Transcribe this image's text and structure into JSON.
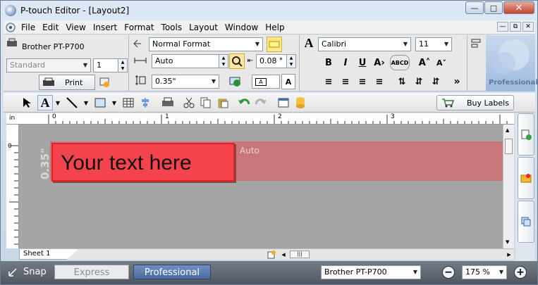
{
  "window": {
    "title": "P-touch Editor - [Layout2]"
  },
  "menu": [
    "File",
    "Edit",
    "View",
    "Insert",
    "Format",
    "Tools",
    "Layout",
    "Window",
    "Help"
  ],
  "printer_group": {
    "printer": "Brother PT-P700",
    "mode": "Standard",
    "copies": "1",
    "print_label": "Print"
  },
  "format_group": {
    "format": "Normal Format",
    "length": "Auto",
    "margin": "0.08 \"",
    "width": "0.35\""
  },
  "font_group": {
    "font": "Calibri",
    "size": "11"
  },
  "professional_badge": "Professional",
  "toolbar": {
    "buy_labels": "Buy Labels"
  },
  "ruler": {
    "unit": "in",
    "labels": [
      "0",
      "1",
      "2",
      "3"
    ],
    "vlabel": "0"
  },
  "label": {
    "text": "Your text here",
    "length_text": "Auto",
    "height_text": "0.35\""
  },
  "sheet": {
    "tab": "Sheet 1"
  },
  "status": {
    "snap": "Snap",
    "express": "Express",
    "professional": "Professional",
    "printer": "Brother PT-P700",
    "zoom": "175 %"
  }
}
